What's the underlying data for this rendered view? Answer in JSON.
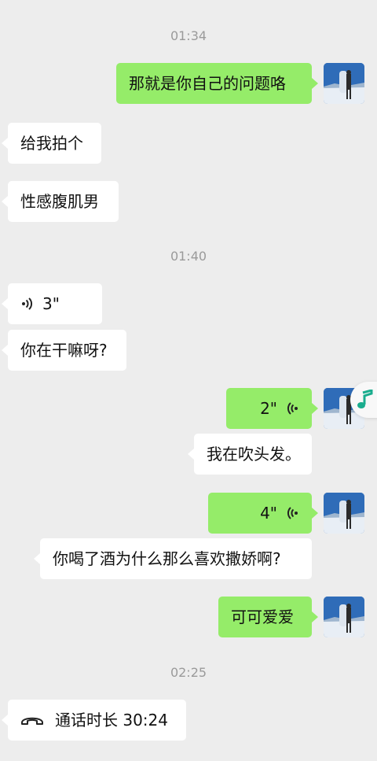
{
  "timestamps": [
    "01:34",
    "01:40",
    "02:25"
  ],
  "messages": {
    "m1": "那就是你自己的问题咯",
    "m2": "给我拍个",
    "m3": "性感腹肌男",
    "m4_duration": "3\"",
    "m5": "你在干嘛呀?",
    "m6_duration": "2\"",
    "m7": "我在吹头发。",
    "m8_duration": "4\"",
    "m9": "你喝了酒为什么那么喜欢撒娇啊?",
    "m10": "可可爱爱"
  },
  "call": {
    "label": "通话时长 30:24"
  },
  "colors": {
    "background": "#ededed",
    "outgoing_bubble": "#95ec69",
    "incoming_bubble": "#ffffff",
    "music_icon": "#1aad8e"
  },
  "icons": [
    "voice-wave-icon",
    "phone-handset-icon",
    "music-note-icon",
    "user-avatar"
  ]
}
